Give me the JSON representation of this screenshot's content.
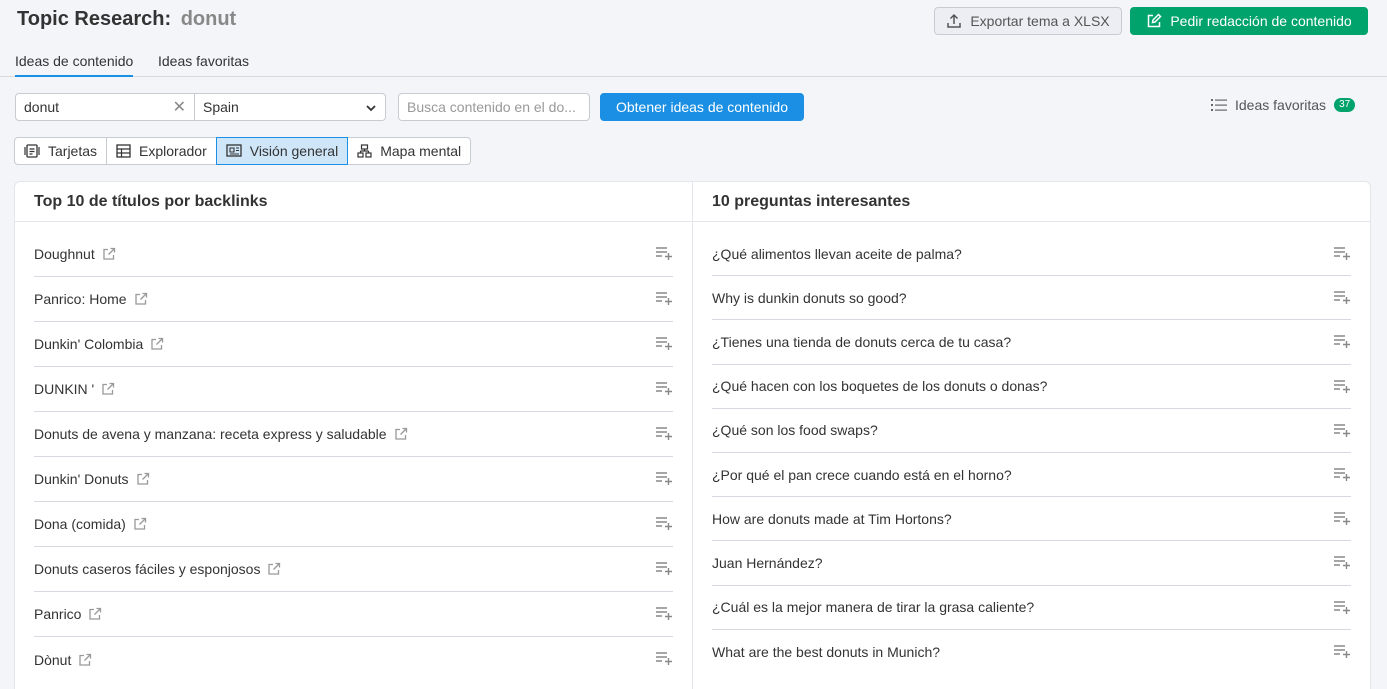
{
  "header": {
    "title": "Topic Research:",
    "query": "donut",
    "export_label": "Exportar tema a XLSX",
    "order_label": "Pedir redacción de contenido"
  },
  "tabs": [
    {
      "label": "Ideas de contenido",
      "active": true
    },
    {
      "label": "Ideas favoritas",
      "active": false
    }
  ],
  "search": {
    "topic_value": "donut",
    "country": "Spain",
    "content_placeholder": "Busca contenido en el do...",
    "submit_label": "Obtener ideas de contenido",
    "favorites_label": "Ideas favoritas",
    "favorites_count": "37"
  },
  "views": [
    {
      "label": "Tarjetas",
      "icon": "cards-icon",
      "active": false
    },
    {
      "label": "Explorador",
      "icon": "table-icon",
      "active": false
    },
    {
      "label": "Visión general",
      "icon": "overview-icon",
      "active": true
    },
    {
      "label": "Mapa mental",
      "icon": "mindmap-icon",
      "active": false
    }
  ],
  "colors": {
    "accent": "#1a8fe3",
    "green": "#00a36b"
  },
  "left_panel": {
    "title": "Top 10 de títulos por backlinks",
    "items": [
      "Doughnut",
      "Panrico: Home",
      "Dunkin' Colombia",
      "DUNKIN '",
      "Donuts de avena y manzana: receta express y saludable",
      "Dunkin' Donuts",
      "Dona (comida)",
      "Donuts caseros fáciles y esponjosos",
      "Panrico",
      "Dònut"
    ]
  },
  "right_panel": {
    "title": "10 preguntas interesantes",
    "items": [
      "¿Qué alimentos llevan aceite de palma?",
      "Why is dunkin donuts so good?",
      "¿Tienes una tienda de donuts cerca de tu casa?",
      "¿Qué hacen con los boquetes de los donuts o donas?",
      "¿Qué son los food swaps?",
      "¿Por qué el pan crece cuando está en el horno?",
      "How are donuts made at Tim Hortons?",
      "Juan Hernández?",
      "¿Cuál es la mejor manera de tirar la grasa caliente?",
      "What are the best donuts in Munich?"
    ]
  }
}
